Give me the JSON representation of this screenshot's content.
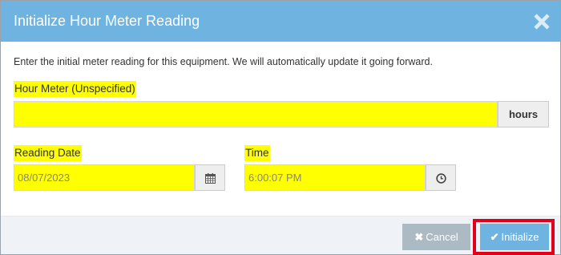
{
  "dialog": {
    "title": "Initialize Hour Meter Reading",
    "intro": "Enter the initial meter reading for this equipment. We will automatically update it going forward."
  },
  "hour_meter": {
    "label": "Hour Meter (Unspecified)",
    "value": "",
    "unit": "hours"
  },
  "reading_date": {
    "label": "Reading Date",
    "value": "08/07/2023",
    "icon": "calendar-icon"
  },
  "time": {
    "label": "Time",
    "value": "6:00:07 PM",
    "icon": "clock-icon"
  },
  "buttons": {
    "cancel": "Cancel",
    "cancel_icon": "✖",
    "initialize": "Initialize",
    "initialize_icon": "✔"
  },
  "colors": {
    "header": "#6fb3e0",
    "highlight": "#ffff00",
    "cancel_button": "#abbac3",
    "initialize_button": "#6fb3e0",
    "focus_outline": "#e0001b"
  }
}
